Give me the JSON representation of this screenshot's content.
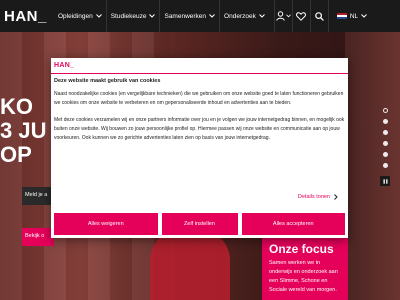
{
  "header": {
    "logo": "HAN_",
    "nav": [
      {
        "label": "Opleidingen"
      },
      {
        "label": "Studiekeuze"
      },
      {
        "label": "Samenwerken"
      },
      {
        "label": "Onderzoek"
      }
    ],
    "icons": [
      "user-icon",
      "heart-icon",
      "search-icon"
    ],
    "language": "NL"
  },
  "hero": {
    "title_lines": [
      "KO",
      "3 JU",
      "OP"
    ],
    "button_primary": "Meld je a",
    "button_secondary": "Bekijk o"
  },
  "focus": {
    "title": "Onze focus",
    "text": "Samen werken we in onderwijs en onderzoek aan een Slimme, Schone en Sociale wereld van morgen."
  },
  "cookie": {
    "logo": "HAN_",
    "title": "Deze website maakt gebruik van cookies",
    "paragraph1": "Naast noodzakelijke cookies (en vergelijkbare technieken) die we gebruiken om onze website goed te laten functioneren gebruiken we cookies om onze website te verbeteren en om gepersonaliseerde inhoud en advertenties aan te bieden.",
    "paragraph2": "Met deze cookies verzamelen wij en onze partners informatie over jou en je volgen we jouw internetgedrag binnen, en mogelijk ook buiten onze website. Wij bouwen zo jouw persoonlijke profiel op. Hiermee passen wij onze website en communicatie aan op jouw voorkeuren. Ook kunnen we zo gerichte advertenties laten zien op basis van jouw internetgedrag.",
    "details_label": "Details tonen",
    "buttons": {
      "reject": "Alles weigeren",
      "customize": "Zelf instellen",
      "accept": "Alles accepteren"
    }
  },
  "colors": {
    "brand": "#e5005a",
    "header_bg": "#1a1a1a"
  }
}
